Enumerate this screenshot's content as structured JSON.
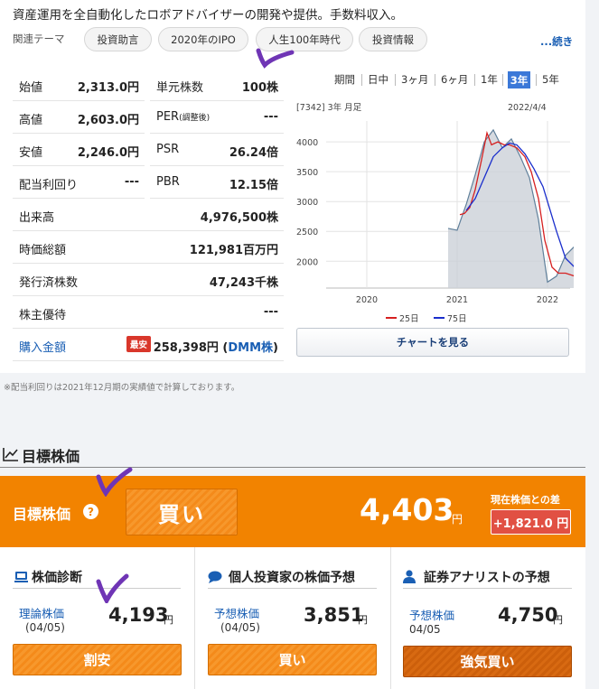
{
  "description": "資産運用を全自動化したロボアドバイザーの開発や提供。手数料収入。",
  "theme_label": "関連テーマ",
  "themes": [
    "投資助言",
    "2020年のIPO",
    "人生100年時代",
    "投資情報"
  ],
  "more_label": "...続き",
  "stats_left": [
    {
      "k": "始値",
      "v": "2,313.0円"
    },
    {
      "k": "高値",
      "v": "2,603.0円"
    },
    {
      "k": "安値",
      "v": "2,246.0円"
    },
    {
      "k": "配当利回り",
      "v": "---"
    }
  ],
  "stats_right": [
    {
      "k": "単元株数",
      "v": "100株"
    },
    {
      "k": "PER",
      "k_small": "(調整後)",
      "v": "---"
    },
    {
      "k": "PSR",
      "v": "26.24倍"
    },
    {
      "k": "PBR",
      "v": "12.15倍"
    }
  ],
  "stats_full": [
    {
      "k": "出来高",
      "v": "4,976,500株"
    },
    {
      "k": "時価総額",
      "v": "121,981百万円"
    },
    {
      "k": "発行済株数",
      "v": "47,243千株"
    },
    {
      "k": "株主優待",
      "v": "---"
    }
  ],
  "purchase": {
    "label": "購入金額",
    "badge": "最安",
    "value": "258,398円 (",
    "broker": "DMM株",
    "close": ")"
  },
  "periods": {
    "label": "期間",
    "items": [
      "日中",
      "3ヶ月",
      "6ヶ月",
      "1年",
      "3年",
      "5年"
    ],
    "active": "3年"
  },
  "chart_header": {
    "code": "[7342] 3年 月足",
    "date": "2022/4/4"
  },
  "chart_button": "チャートを見る",
  "chart_data": {
    "type": "area",
    "x_ticks": [
      "2020",
      "2021",
      "2022"
    ],
    "y_ticks": [
      "4000",
      "3500",
      "3000",
      "2500",
      "2000"
    ],
    "ylim": [
      1550,
      4350
    ],
    "price": [
      [
        2020.9,
        2550
      ],
      [
        2021.0,
        2520
      ],
      [
        2021.1,
        2950
      ],
      [
        2021.2,
        3450
      ],
      [
        2021.3,
        4000
      ],
      [
        2021.4,
        4200
      ],
      [
        2021.5,
        3900
      ],
      [
        2021.6,
        4050
      ],
      [
        2021.7,
        3750
      ],
      [
        2021.8,
        3400
      ],
      [
        2021.9,
        2700
      ],
      [
        2022.0,
        1650
      ],
      [
        2022.1,
        1750
      ],
      [
        2022.2,
        2100
      ],
      [
        2022.3,
        2250
      ]
    ],
    "series": [
      {
        "name": "25日",
        "color": "#d62020",
        "points": [
          [
            2021.03,
            2780
          ],
          [
            2021.08,
            2800
          ],
          [
            2021.14,
            2900
          ],
          [
            2021.2,
            3200
          ],
          [
            2021.27,
            3700
          ],
          [
            2021.33,
            4150
          ],
          [
            2021.38,
            3950
          ],
          [
            2021.45,
            4000
          ],
          [
            2021.52,
            3950
          ],
          [
            2021.58,
            3950
          ],
          [
            2021.66,
            3900
          ],
          [
            2021.75,
            3750
          ],
          [
            2021.82,
            3500
          ],
          [
            2021.9,
            3050
          ],
          [
            2021.97,
            2350
          ],
          [
            2022.05,
            1900
          ],
          [
            2022.12,
            1800
          ],
          [
            2022.2,
            1800
          ],
          [
            2022.3,
            1750
          ]
        ]
      },
      {
        "name": "75日",
        "color": "#1a2ecc",
        "points": [
          [
            2021.1,
            2850
          ],
          [
            2021.2,
            3050
          ],
          [
            2021.3,
            3400
          ],
          [
            2021.4,
            3750
          ],
          [
            2021.5,
            3900
          ],
          [
            2021.58,
            3980
          ],
          [
            2021.66,
            3950
          ],
          [
            2021.75,
            3800
          ],
          [
            2021.85,
            3550
          ],
          [
            2021.95,
            3250
          ],
          [
            2022.02,
            2900
          ],
          [
            2022.1,
            2500
          ],
          [
            2022.2,
            2050
          ],
          [
            2022.3,
            1900
          ]
        ]
      }
    ]
  },
  "section_title": "目標株価",
  "target": {
    "label": "目標株価",
    "help": "?",
    "rating": "買い",
    "price": "4,403",
    "unit": "円",
    "diff_label": "現在株価との差",
    "diff": "+1,821.0 円"
  },
  "columns": [
    {
      "title": "株価診断",
      "label": "理論株価",
      "date": "(04/05)",
      "value": "4,193",
      "unit": "円",
      "button": "割安"
    },
    {
      "title": "個人投資家の株価予想",
      "label": "予想株価",
      "date": "(04/05)",
      "value": "3,851",
      "unit": "円",
      "button": "買い"
    },
    {
      "title": "証券アナリストの予想",
      "label": "予想株価",
      "date": "04/05",
      "value": "4,750",
      "unit": "円",
      "button": "強気買い"
    }
  ]
}
